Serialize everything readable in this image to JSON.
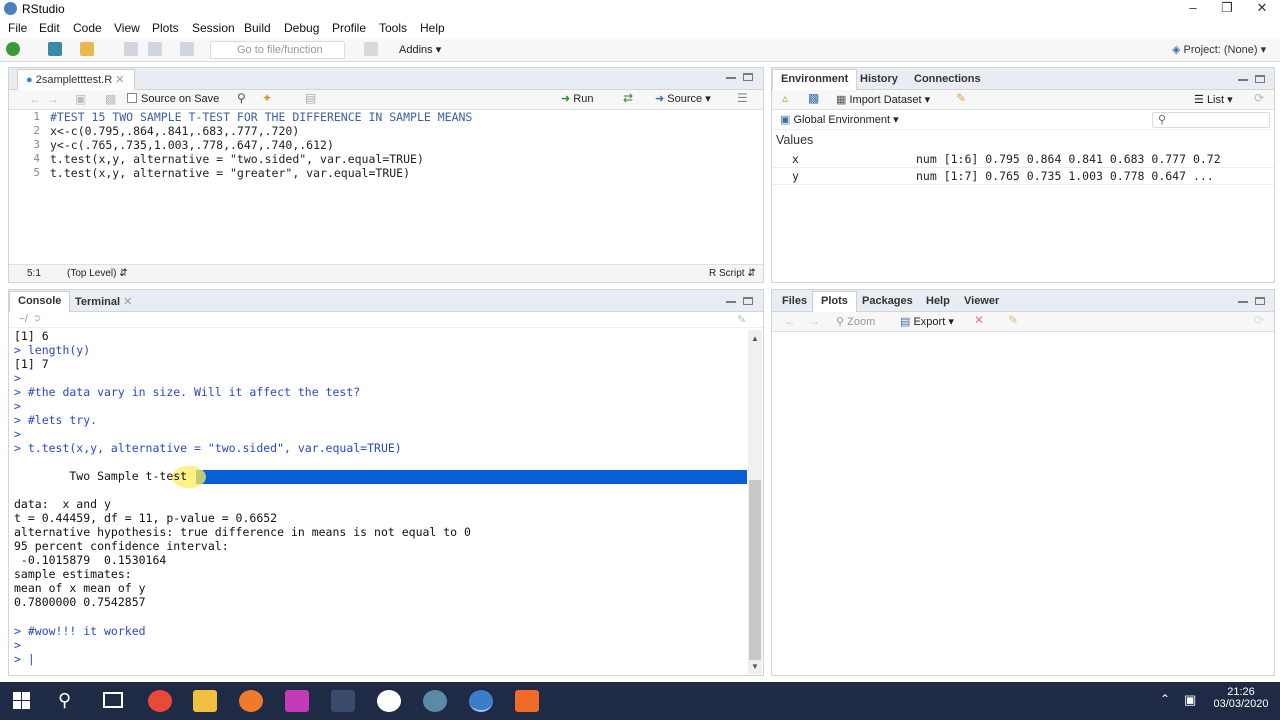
{
  "window": {
    "title": "RStudio"
  },
  "menu": [
    "File",
    "Edit",
    "Code",
    "View",
    "Plots",
    "Session",
    "Build",
    "Debug",
    "Profile",
    "Tools",
    "Help"
  ],
  "toolbar": {
    "goto_placeholder": "Go to file/function",
    "addins": "Addins",
    "project": "Project: (None)"
  },
  "editor": {
    "tab_label": "2sampletttest.R",
    "source_on_save": "Source on Save",
    "run_label": "Run",
    "source_label": "Source",
    "lines": [
      {
        "num": "1",
        "text": "#TEST 15 TWO SAMPLE T-TEST FOR THE DIFFERENCE IN SAMPLE MEANS"
      },
      {
        "num": "2",
        "text": "x<-c(0.795,.864,.841,.683,.777,.720)"
      },
      {
        "num": "3",
        "text": "y<-c(.765,.735,1.003,.778,.647,.740,.612)"
      },
      {
        "num": "4",
        "text": "t.test(x,y, alternative = \"two.sided\", var.equal=TRUE)"
      },
      {
        "num": "5",
        "text": "t.test(x,y, alternative = \"greater\", var.equal=TRUE)"
      }
    ],
    "status_pos": "5:1",
    "status_level": "(Top Level)",
    "status_type": "R Script"
  },
  "console": {
    "tab_console": "Console",
    "tab_terminal": "Terminal",
    "path": "~/",
    "lines": [
      {
        "text": "[1] 6",
        "cls": "out"
      },
      {
        "text": "> length(y)",
        "cls": "blue"
      },
      {
        "text": "[1] 7",
        "cls": "out"
      },
      {
        "text": ">",
        "cls": "blue"
      },
      {
        "text": "> #the data vary in size. Will it affect the test?",
        "cls": "blue"
      },
      {
        "text": ">",
        "cls": "blue"
      },
      {
        "text": "> #lets try.",
        "cls": "blue"
      },
      {
        "text": ">",
        "cls": "blue"
      },
      {
        "text": "> t.test(x,y, alternative = \"two.sided\", var.equal=TRUE)",
        "cls": "blue"
      },
      {
        "text": "",
        "cls": "out"
      },
      {
        "text": "        Two Sample t-test",
        "cls": "out"
      },
      {
        "text": "",
        "cls": "out"
      },
      {
        "text": "data:  x and y",
        "cls": "out"
      },
      {
        "text": "t = 0.44459, df = 11, p-value = 0.6652",
        "cls": "out"
      },
      {
        "text": "alternative hypothesis: true difference in means is not equal to 0",
        "cls": "out"
      },
      {
        "text": "95 percent confidence interval:",
        "cls": "out"
      },
      {
        "text": " -0.1015879  0.1530164",
        "cls": "out"
      },
      {
        "text": "sample estimates:",
        "cls": "out"
      },
      {
        "text": "mean of x mean of y",
        "cls": "out"
      },
      {
        "text": "0.7800000 0.7542857",
        "cls": "out"
      },
      {
        "text": "",
        "cls": "out"
      },
      {
        "text": "> #wow!!! it worked",
        "cls": "blue"
      },
      {
        "text": ">",
        "cls": "blue"
      },
      {
        "text": "> |",
        "cls": "blue"
      }
    ]
  },
  "env": {
    "tabs": [
      "Environment",
      "History",
      "Connections"
    ],
    "import_label": "Import Dataset",
    "list_label": "List",
    "global_env": "Global Environment",
    "section": "Values",
    "rows": [
      {
        "name": "x",
        "value": "num [1:6] 0.795 0.864 0.841 0.683 0.777 0.72"
      },
      {
        "name": "y",
        "value": "num [1:7] 0.765 0.735 1.003 0.778 0.647 ..."
      }
    ]
  },
  "files": {
    "tabs": [
      "Files",
      "Plots",
      "Packages",
      "Help",
      "Viewer"
    ],
    "zoom_label": "Zoom",
    "export_label": "Export"
  },
  "taskbar": {
    "time": "21:26",
    "date": "03/03/2020"
  }
}
